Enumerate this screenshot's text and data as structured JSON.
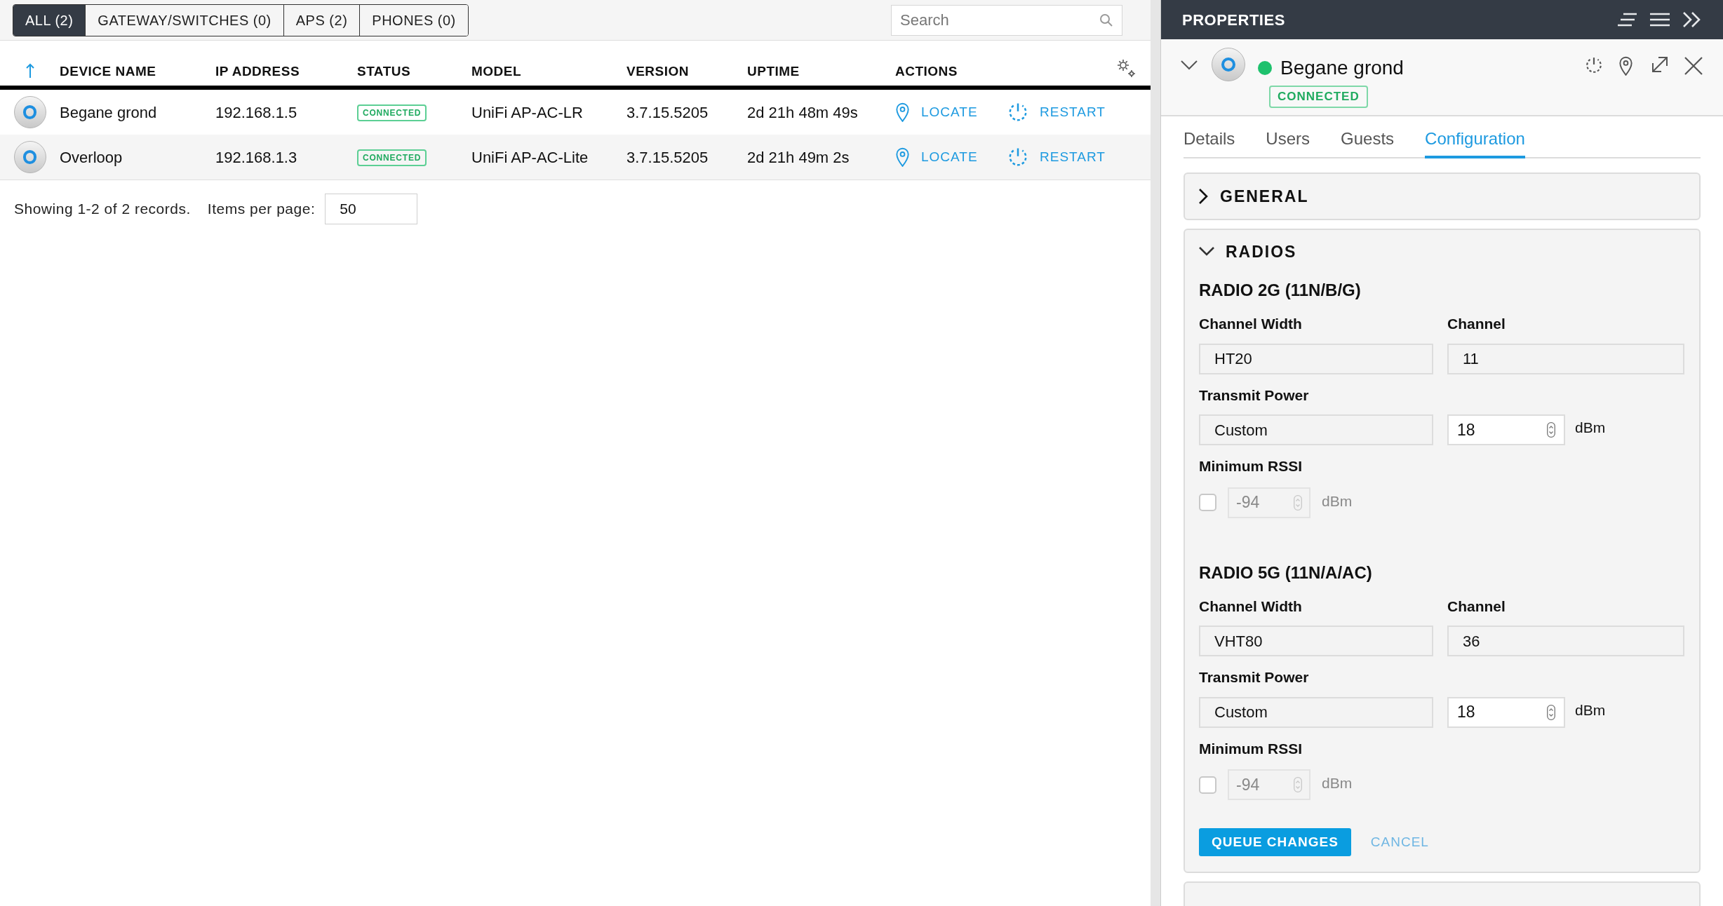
{
  "filter_tabs": [
    {
      "label": "ALL (2)",
      "selected": true
    },
    {
      "label": "GATEWAY/SWITCHES (0)",
      "selected": false
    },
    {
      "label": "APS (2)",
      "selected": false
    },
    {
      "label": "PHONES (0)",
      "selected": false
    }
  ],
  "search": {
    "placeholder": "Search"
  },
  "table": {
    "columns": [
      "DEVICE NAME",
      "IP ADDRESS",
      "STATUS",
      "MODEL",
      "VERSION",
      "UPTIME",
      "ACTIONS"
    ],
    "rows": [
      {
        "name": "Begane grond",
        "ip": "192.168.1.5",
        "status": "CONNECTED",
        "model": "UniFi AP-AC-LR",
        "version": "3.7.15.5205",
        "uptime": "2d 21h 48m 49s",
        "actions": [
          {
            "kind": "locate",
            "label": "LOCATE"
          },
          {
            "kind": "restart",
            "label": "RESTART"
          }
        ]
      },
      {
        "name": "Overloop",
        "ip": "192.168.1.3",
        "status": "CONNECTED",
        "model": "UniFi AP-AC-Lite",
        "version": "3.7.15.5205",
        "uptime": "2d 21h 49m 2s",
        "actions": [
          {
            "kind": "locate",
            "label": "LOCATE"
          },
          {
            "kind": "restart",
            "label": "RESTART"
          }
        ]
      }
    ]
  },
  "footer": {
    "summary": "Showing 1-2 of 2 records.",
    "items_per_page_label": "Items per page:",
    "items_per_page": "50"
  },
  "properties": {
    "title": "PROPERTIES",
    "device": {
      "name": "Begane grond",
      "status": "CONNECTED",
      "online": true
    },
    "tabs": [
      {
        "label": "Details",
        "selected": false
      },
      {
        "label": "Users",
        "selected": false
      },
      {
        "label": "Guests",
        "selected": false
      },
      {
        "label": "Configuration",
        "selected": true
      }
    ],
    "sections": [
      {
        "title": "GENERAL",
        "expanded": false
      },
      {
        "title": "RADIOS",
        "expanded": true,
        "radios": [
          {
            "title": "RADIO 2G (11N/B/G)",
            "channel_width_label": "Channel Width",
            "channel_width": "HT20",
            "channel_label": "Channel",
            "channel": "11",
            "tx_power_label": "Transmit Power",
            "tx_power_mode": "Custom",
            "tx_power": "18",
            "tx_unit": "dBm",
            "min_rssi_label": "Minimum RSSI",
            "min_rssi_enabled": false,
            "min_rssi": "-94",
            "min_rssi_unit": "dBm"
          },
          {
            "title": "RADIO 5G (11N/A/AC)",
            "channel_width_label": "Channel Width",
            "channel_width": "VHT80",
            "channel_label": "Channel",
            "channel": "36",
            "tx_power_label": "Transmit Power",
            "tx_power_mode": "Custom",
            "tx_power": "18",
            "tx_unit": "dBm",
            "min_rssi_label": "Minimum RSSI",
            "min_rssi_enabled": false,
            "min_rssi": "-94",
            "min_rssi_unit": "dBm"
          }
        ]
      }
    ],
    "queue_button": "QUEUE CHANGES",
    "cancel_button": {
      "label": "CANCEL",
      "disabled": true
    }
  }
}
